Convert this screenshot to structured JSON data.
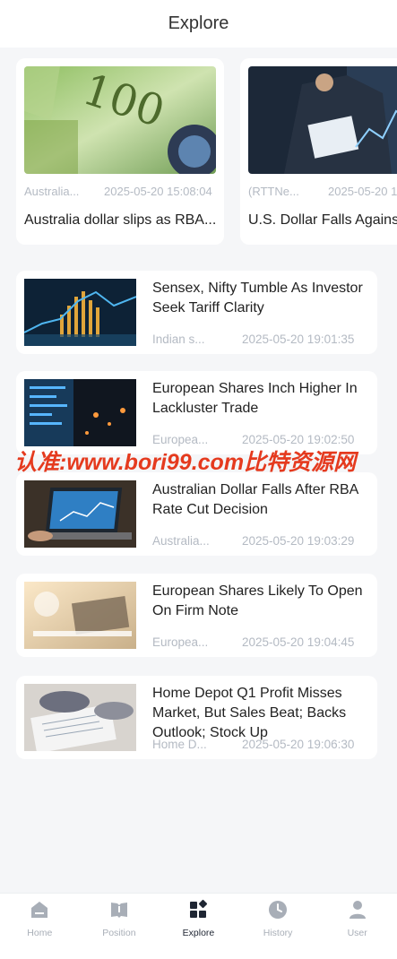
{
  "header": {
    "title": "Explore"
  },
  "featured": [
    {
      "source": "Australia...",
      "time": "2025-05-20 15:08:04",
      "headline": "Australia dollar slips as RBA..."
    },
    {
      "source": "(RTTNe...",
      "time": "2025-05-20 1",
      "headline": "U.S. Dollar Falls Agains"
    }
  ],
  "news": [
    {
      "headline": "Sensex, Nifty Tumble As Investor Seek Tariff Clarity",
      "source": "Indian s...",
      "time": "2025-05-20 19:01:35"
    },
    {
      "headline": "European Shares Inch Higher In Lackluster Trade",
      "source": "Europea...",
      "time": "2025-05-20 19:02:50"
    },
    {
      "headline": "Australian Dollar Falls After RBA Rate Cut Decision",
      "source": "Australia...",
      "time": "2025-05-20 19:03:29"
    },
    {
      "headline": "European Shares Likely To Open On Firm Note",
      "source": "Europea...",
      "time": "2025-05-20 19:04:45"
    },
    {
      "headline": "Home Depot Q1 Profit Misses Market, But Sales Beat; Backs Outlook; Stock Up",
      "source": "Home D...",
      "time": "2025-05-20 19:06:30"
    }
  ],
  "watermark": "认准:www.bori99.com比特资源网",
  "tabbar": {
    "items": [
      {
        "label": "Home",
        "icon": "home-icon"
      },
      {
        "label": "Position",
        "icon": "position-icon"
      },
      {
        "label": "Explore",
        "icon": "explore-icon",
        "active": true
      },
      {
        "label": "History",
        "icon": "history-icon"
      },
      {
        "label": "User",
        "icon": "user-icon"
      }
    ]
  },
  "colors": {
    "active": "#1f2633",
    "inactive": "#a8aeb7",
    "meta": "#b4bac3",
    "watermark": "#e53a1e"
  }
}
